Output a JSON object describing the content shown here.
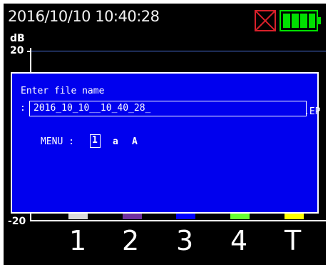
{
  "status_bar": {
    "datetime": "2016/10/10  10:40:28",
    "icons": [
      "no-storage-icon",
      "battery-full-icon"
    ],
    "colors": {
      "error": "#d8202a",
      "battery": "#00e000"
    }
  },
  "graph": {
    "unit": "dB",
    "y_top": "20",
    "y_bottom": "-20"
  },
  "channels": [
    {
      "label": "1",
      "color": "#d9d9d9"
    },
    {
      "label": "2",
      "color": "#7030a0"
    },
    {
      "label": "3",
      "color": "#0000ff"
    },
    {
      "label": "4",
      "color": "#66ff33"
    },
    {
      "label": "T",
      "color": "#ffff00"
    }
  ],
  "dialog": {
    "prompt": "Enter file name",
    "colon": ":",
    "filename": "2016_10_10__10_40_28_",
    "extension": ".EP",
    "menu_label": "MENU :",
    "menu_options": [
      "1",
      "a",
      "A"
    ],
    "background": "#0000ee"
  }
}
